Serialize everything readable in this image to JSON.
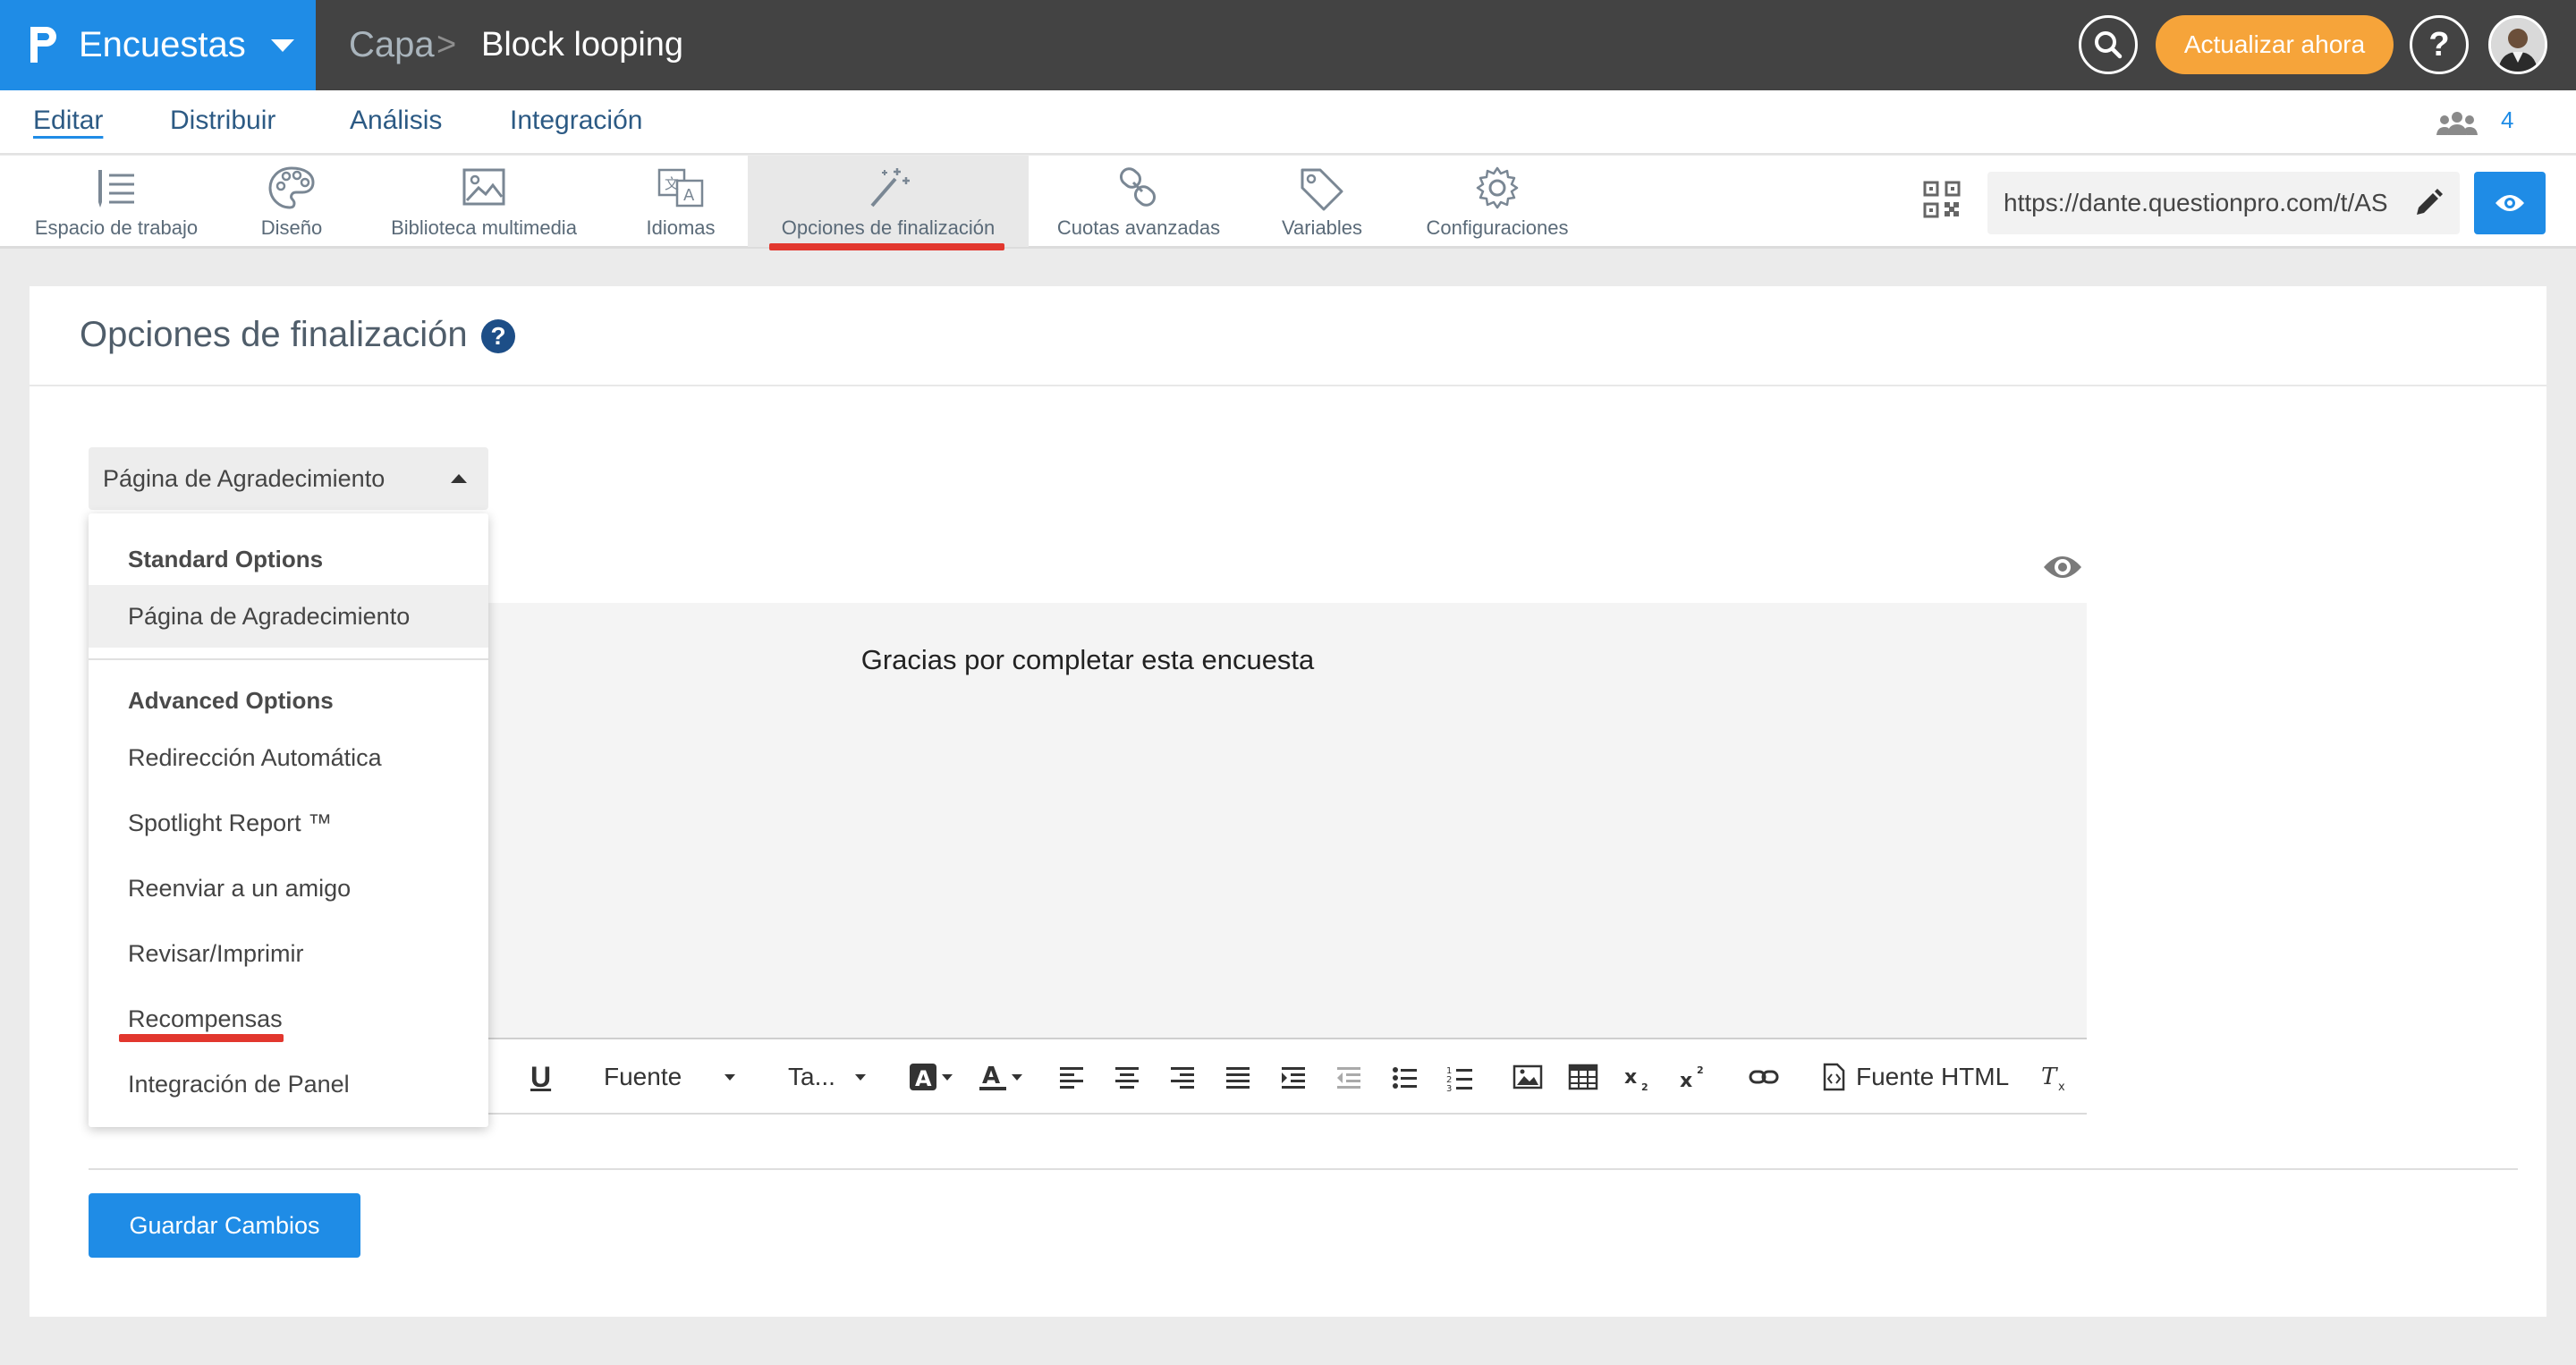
{
  "app": {
    "name": "Encuestas",
    "breadcrumb_parent": "Capa",
    "breadcrumb_sep": ">",
    "breadcrumb_current": "Block looping",
    "upgrade_label": "Actualizar ahora",
    "help_label": "?",
    "brand_color": "#1f8ce6",
    "topbar_color": "#434343",
    "upgrade_color": "#f6a43a"
  },
  "nav": {
    "items": [
      "Editar",
      "Distribuir",
      "Análisis",
      "Integración"
    ],
    "active": "Editar",
    "users_count": "4"
  },
  "toolbar": {
    "items": [
      {
        "label": "Espacio de trabajo",
        "icon": "workspace-icon"
      },
      {
        "label": "Diseño",
        "icon": "palette-icon"
      },
      {
        "label": "Biblioteca multimedia",
        "icon": "image-icon"
      },
      {
        "label": "Idiomas",
        "icon": "translate-icon"
      },
      {
        "label": "Opciones de finalización",
        "icon": "magic-wand-icon"
      },
      {
        "label": "Cuotas avanzadas",
        "icon": "link-icon"
      },
      {
        "label": "Variables",
        "icon": "tag-icon"
      },
      {
        "label": "Configuraciones",
        "icon": "gear-icon"
      }
    ],
    "active": "Opciones de finalización",
    "url": "https://dante.questionpro.com/t/AS",
    "accent_underline": "#e2372e"
  },
  "page": {
    "title": "Opciones de finalización",
    "select_value": "Página de Agradecimiento",
    "editor_text": "Gracias por completar esta encuesta",
    "save_label": "Guardar Cambios"
  },
  "editor_toolbar": {
    "font_label": "Fuente",
    "size_label": "Ta...",
    "html_label": "Fuente HTML"
  },
  "dropdown": {
    "standard_header": "Standard Options",
    "standard_items": [
      "Página de Agradecimiento"
    ],
    "advanced_header": "Advanced Options",
    "advanced_items": [
      "Redirección Automática",
      "Spotlight Report ™",
      "Reenviar a un amigo",
      "Revisar/Imprimir",
      "Recompensas",
      "Integración de Panel"
    ]
  }
}
